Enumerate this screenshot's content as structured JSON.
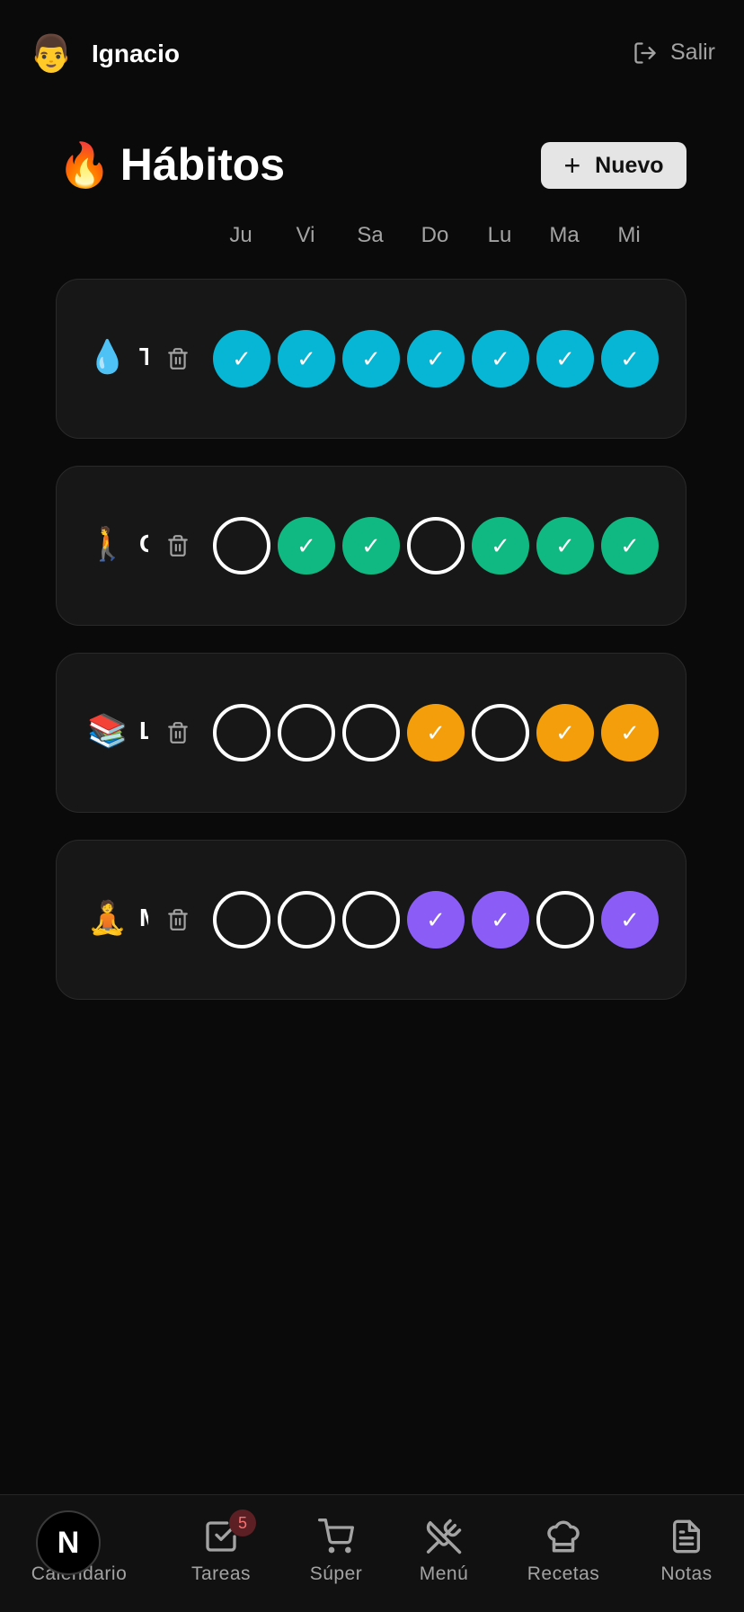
{
  "header": {
    "avatar_emoji": "👨",
    "username": "Ignacio",
    "logout_label": "Salir"
  },
  "page": {
    "title_emoji": "🔥",
    "title": "Hábitos",
    "new_button_label": "Nuevo"
  },
  "days": [
    "Ju",
    "Vi",
    "Sa",
    "Do",
    "Lu",
    "Ma",
    "Mi"
  ],
  "habits": [
    {
      "emoji": "💧",
      "name": "T",
      "color": "#06b6d4",
      "done": [
        true,
        true,
        true,
        true,
        true,
        true,
        true
      ]
    },
    {
      "emoji": "🚶",
      "name": "C",
      "color": "#10b981",
      "done": [
        false,
        true,
        true,
        false,
        true,
        true,
        true
      ]
    },
    {
      "emoji": "📚",
      "name": "L",
      "color": "#f59e0b",
      "done": [
        false,
        false,
        false,
        true,
        false,
        true,
        true
      ]
    },
    {
      "emoji": "🧘",
      "name": "M",
      "color": "#8b5cf6",
      "done": [
        false,
        false,
        false,
        true,
        true,
        false,
        true
      ]
    }
  ],
  "nav": {
    "calendario": "Calendario",
    "tareas": "Tareas",
    "tareas_badge": "5",
    "super": "Súper",
    "menu": "Menú",
    "recetas": "Recetas",
    "notas": "Notas"
  },
  "dev_badge": "N"
}
